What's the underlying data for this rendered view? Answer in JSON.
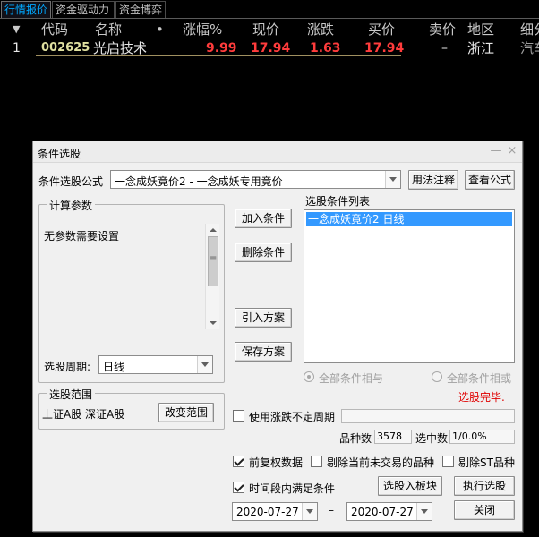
{
  "tabs": [
    "行情报价",
    "资金驱动力",
    "资金博弈"
  ],
  "table": {
    "sort_arrow": "▼",
    "headers": [
      "代码",
      "名称",
      "•",
      "涨幅%",
      "现价",
      "涨跌",
      "买价",
      "卖价",
      "地区",
      "细分"
    ],
    "row": {
      "index": "1",
      "code": "002625",
      "name": "光启技术",
      "change_pct": "9.99",
      "price": "17.94",
      "change": "1.63",
      "bid": "17.94",
      "ask": "–",
      "region": "浙江",
      "sector": "汽车"
    }
  },
  "dialog": {
    "title": "条件选股",
    "formula_label": "条件选股公式",
    "formula_value": "一念成妖竟价2 - 一念成妖专用竟价",
    "usage_button": "用法注释",
    "view_formula_button": "查看公式",
    "params_group": "计算参数",
    "params_text": "无参数需要设置",
    "period_label": "选股周期:",
    "period_value": "日线",
    "range_group": "选股范围",
    "range_text": "上证A股 深证A股",
    "change_range_button": "改变范围",
    "add_condition_button": "加入条件",
    "delete_condition_button": "删除条件",
    "import_plan_button": "引入方案",
    "save_plan_button": "保存方案",
    "conditions_list_label": "选股条件列表",
    "conditions": [
      "一念成妖竟价2   日线"
    ],
    "radio_and": "全部条件相与",
    "radio_or": "全部条件相或",
    "status": "选股完毕.",
    "use_uncertain_period": "使用涨跌不定周期",
    "stock_count_label": "品种数",
    "stock_count_value": "3578",
    "selected_count_label": "选中数",
    "selected_count_value": "1/0.0%",
    "pre_adjusted": "前复权数据",
    "exclude_non_trading": "剔除当前未交易的品种",
    "exclude_st": "剔除ST品种",
    "time_range_condition": "时间段内满足条件",
    "select_to_block_button": "选股入板块",
    "execute_button": "执行选股",
    "close_button": "关闭",
    "date_from": "2020-07-27",
    "date_sep": "–",
    "date_to": "2020-07-27"
  },
  "colors": {
    "up_red": "#ff3c3c",
    "code_yellow": "#e0e0a0",
    "name_white": "#e8e8e8",
    "tab_active": "#00a8ff",
    "status_red": "#e00000",
    "selection_blue": "#3399ff"
  },
  "icons": {
    "minimize": "—",
    "close": "×"
  }
}
